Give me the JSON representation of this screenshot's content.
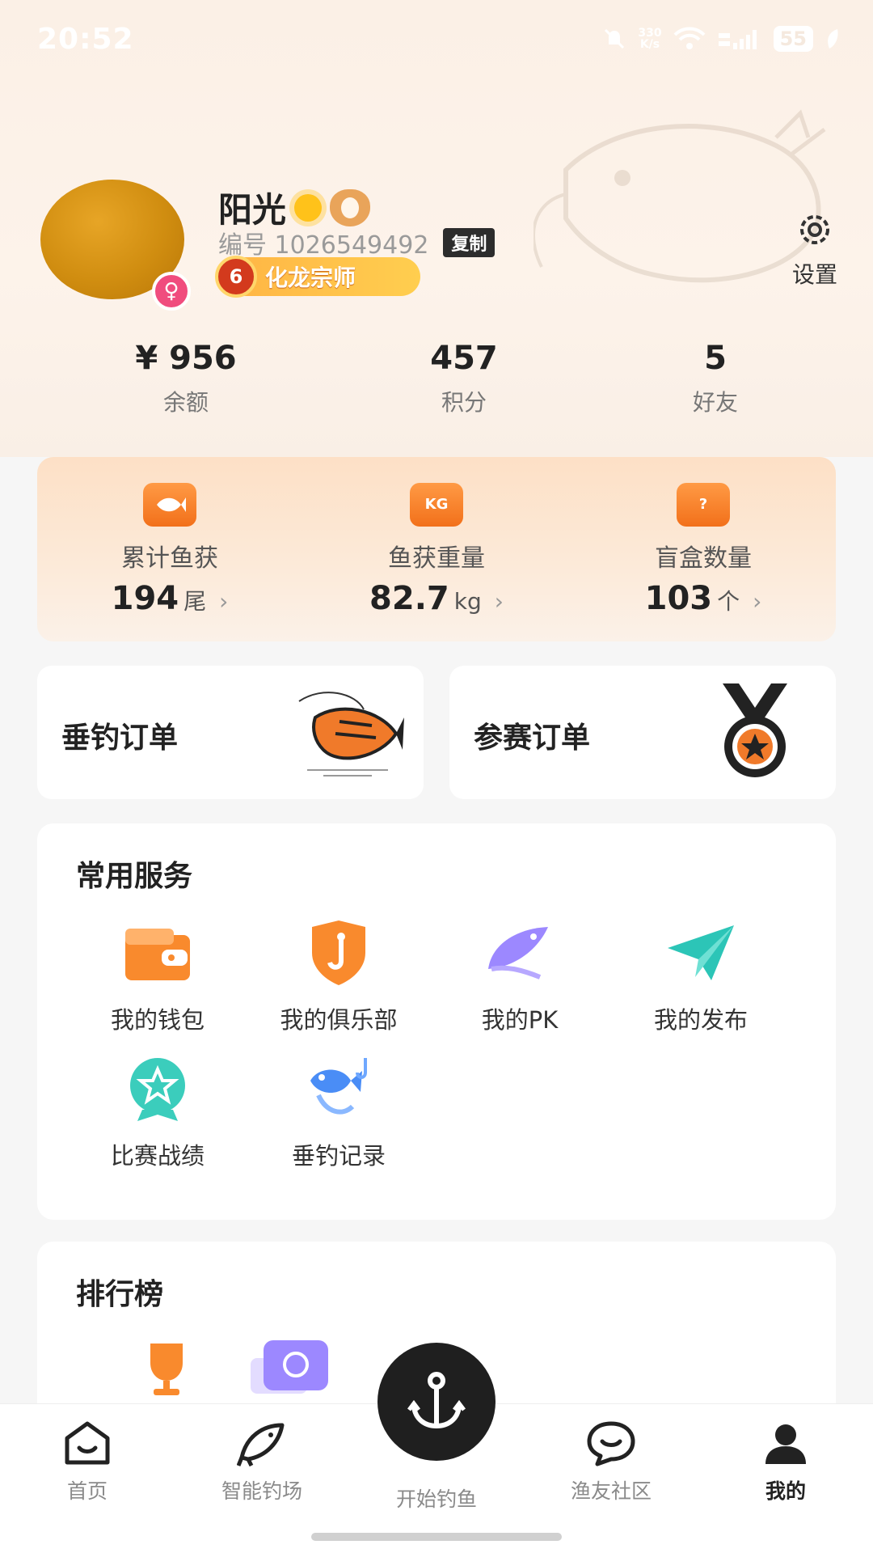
{
  "status_bar": {
    "time": "20:52",
    "net_speed_top": "330",
    "net_speed_bottom": "K/s",
    "battery": "55",
    "icons": [
      "mute-bell-icon",
      "wifi-icon",
      "signal-icon",
      "battery-icon",
      "leaf-icon"
    ]
  },
  "profile": {
    "name": "阳光",
    "id_label": "编号 1026549492",
    "copy_label": "复制",
    "rank_level": "6",
    "rank_title": "化龙宗师",
    "gender": "♀",
    "settings_label": "设置"
  },
  "stats": [
    {
      "value": "¥ 956",
      "label": "余额"
    },
    {
      "value": "457",
      "label": "积分"
    },
    {
      "value": "5",
      "label": "好友"
    }
  ],
  "catch": [
    {
      "label": "累计鱼获",
      "value": "194",
      "unit": "尾",
      "icon": "fish-icon"
    },
    {
      "label": "鱼获重量",
      "value": "82.7",
      "unit": "kg",
      "icon": "weight-kg-icon",
      "icon_text": "KG"
    },
    {
      "label": "盲盒数量",
      "value": "103",
      "unit": "个",
      "icon": "blind-box-icon",
      "icon_text": "?"
    }
  ],
  "orders": {
    "fishing": "垂钓订单",
    "contest": "参赛订单"
  },
  "services": {
    "title": "常用服务",
    "items": [
      {
        "label": "我的钱包",
        "icon": "wallet-icon"
      },
      {
        "label": "我的俱乐部",
        "icon": "club-shield-icon"
      },
      {
        "label": "我的PK",
        "icon": "pk-fish-icon"
      },
      {
        "label": "我的发布",
        "icon": "send-icon"
      },
      {
        "label": "比赛战绩",
        "icon": "star-badge-icon"
      },
      {
        "label": "垂钓记录",
        "icon": "fish-hook-icon"
      }
    ]
  },
  "ranking": {
    "title": "排行榜"
  },
  "nav": {
    "items": [
      {
        "label": "首页",
        "icon": "home-icon"
      },
      {
        "label": "智能钓场",
        "icon": "fish-outline-icon"
      },
      {
        "label": "开始钓鱼",
        "icon": "anchor-icon"
      },
      {
        "label": "渔友社区",
        "icon": "chat-icon"
      },
      {
        "label": "我的",
        "icon": "user-icon"
      }
    ],
    "active": "我的"
  },
  "colors": {
    "accent_orange": "#f2701a",
    "badge_gold": "#ffce4f",
    "dark": "#1f1f1f"
  }
}
